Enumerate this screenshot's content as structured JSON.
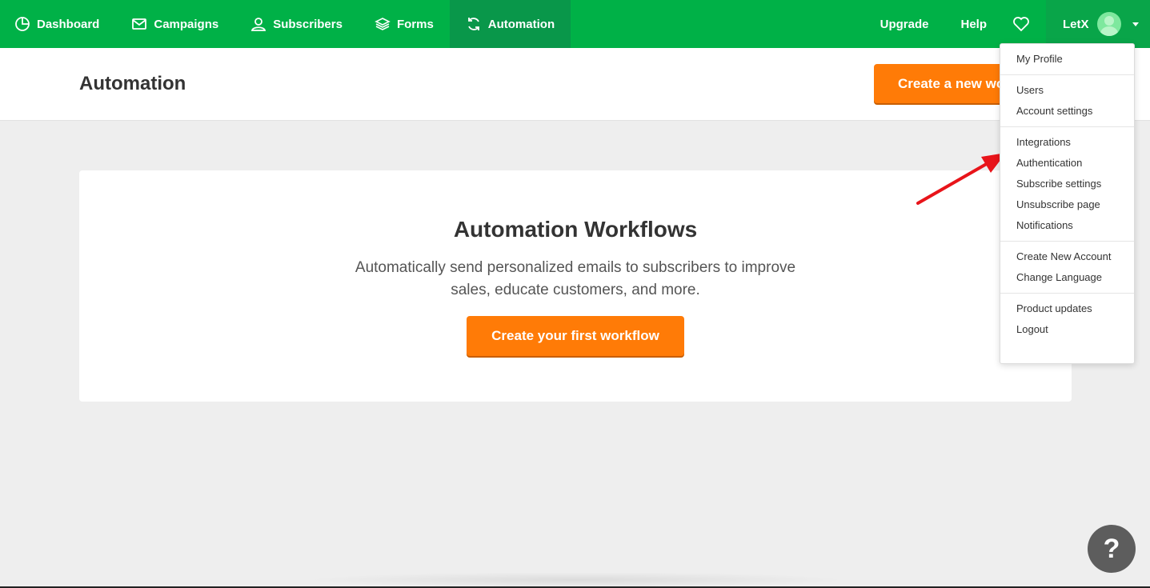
{
  "nav": {
    "items": [
      {
        "label": "Dashboard",
        "icon": "dashboard-icon"
      },
      {
        "label": "Campaigns",
        "icon": "mail-icon"
      },
      {
        "label": "Subscribers",
        "icon": "user-icon"
      },
      {
        "label": "Forms",
        "icon": "layers-icon"
      },
      {
        "label": "Automation",
        "icon": "refresh-icon",
        "active": true
      }
    ],
    "upgrade": "Upgrade",
    "help": "Help",
    "user_name": "LetX"
  },
  "header": {
    "title": "Automation",
    "create_button": "Create a new workflow"
  },
  "card": {
    "title": "Automation Workflows",
    "description": "Automatically send personalized emails to subscribers to improve sales, educate customers, and more.",
    "button": "Create your first workflow"
  },
  "dropdown": {
    "groups": [
      [
        "My Profile"
      ],
      [
        "Users",
        "Account settings"
      ],
      [
        "Integrations",
        "Authentication",
        "Subscribe settings",
        "Unsubscribe page",
        "Notifications"
      ],
      [
        "Create New Account",
        "Change Language"
      ],
      [
        "Product updates",
        "Logout"
      ]
    ]
  },
  "help_button": "?",
  "colors": {
    "nav_bg": "#00b147",
    "nav_active": "#09974a",
    "accent": "#ff7b07",
    "arrow": "#e8141a"
  }
}
